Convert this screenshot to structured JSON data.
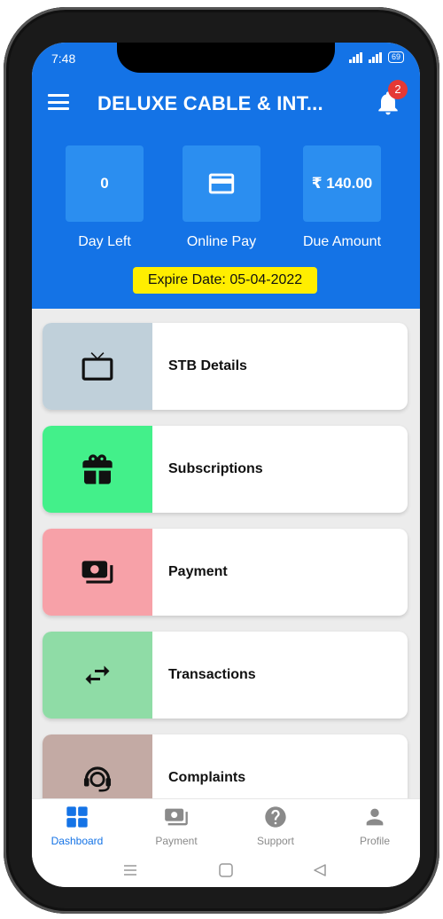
{
  "status_bar": {
    "time": "7:48",
    "battery": "69"
  },
  "header": {
    "title": "DELUXE CABLE & INT...",
    "notification_count": "2",
    "accent_color": "#1473e6"
  },
  "summary": {
    "days_left_value": "0",
    "days_left_label": "Day Left",
    "online_pay_label": "Online Pay",
    "due_amount_value": "₹ 140.00",
    "due_amount_label": "Due Amount",
    "expire_text": "Expire Date: 05-04-2022"
  },
  "menu": {
    "items": [
      {
        "label": "STB Details",
        "icon": "tv-icon",
        "color": "#c0d0da"
      },
      {
        "label": "Subscriptions",
        "icon": "gift-icon",
        "color": "#43f08a"
      },
      {
        "label": "Payment",
        "icon": "money-icon",
        "color": "#f7a1a8"
      },
      {
        "label": "Transactions",
        "icon": "swap-icon",
        "color": "#8fdca6"
      },
      {
        "label": "Complaints",
        "icon": "support-agent-icon",
        "color": "#c3aaa4"
      }
    ]
  },
  "bottom_nav": {
    "items": [
      {
        "label": "Dashboard",
        "icon": "dashboard-icon",
        "active": true
      },
      {
        "label": "Payment",
        "icon": "payment-icon"
      },
      {
        "label": "Support",
        "icon": "help-icon"
      },
      {
        "label": "Profile",
        "icon": "person-icon"
      }
    ]
  }
}
